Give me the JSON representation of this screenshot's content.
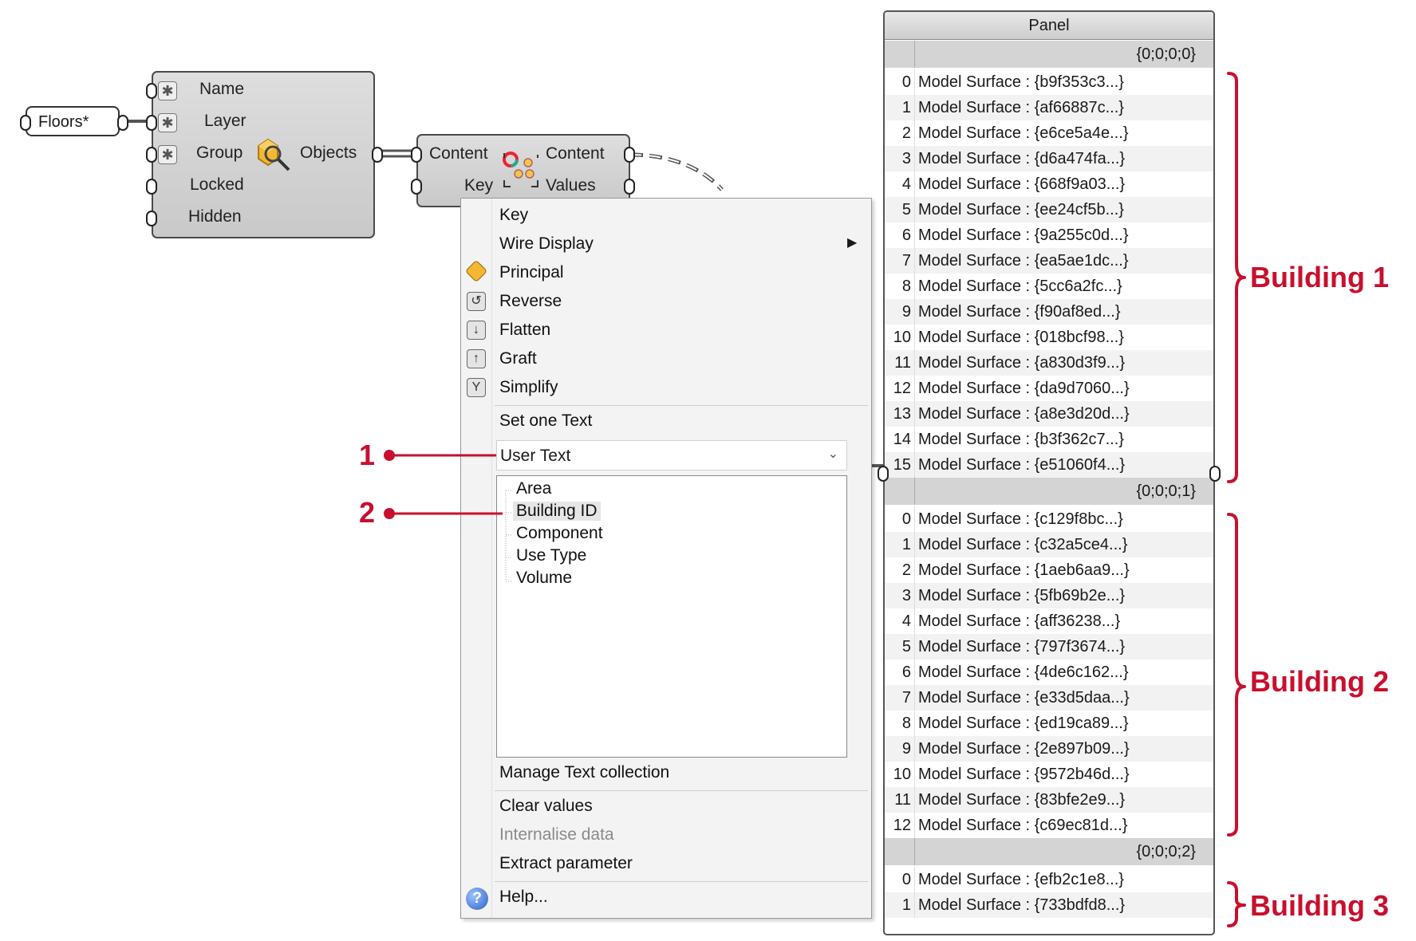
{
  "colors": {
    "annotation": "#c8102e",
    "panel_header": "#d4d4d4",
    "component": "#d2d2d2"
  },
  "floors": {
    "label": "Floors*"
  },
  "query": {
    "inputs": [
      "Name",
      "Layer",
      "Group",
      "Locked",
      "Hidden"
    ],
    "output": "Objects",
    "icon": "magnifier-query-icon"
  },
  "usertext": {
    "inputs": [
      "Content",
      "Key"
    ],
    "outputs": [
      "Content",
      "Values"
    ],
    "icon": "color-circles-icon"
  },
  "menu": {
    "items": [
      {
        "label": "Key",
        "icon": ""
      },
      {
        "label": "Wire Display",
        "icon": "",
        "submenu": true
      },
      {
        "label": "Principal",
        "icon": "principal-icon"
      },
      {
        "label": "Reverse",
        "icon": "reverse-icon"
      },
      {
        "label": "Flatten",
        "icon": "flatten-icon"
      },
      {
        "label": "Graft",
        "icon": "graft-icon"
      },
      {
        "label": "Simplify",
        "icon": "simplify-icon"
      }
    ],
    "set_one_text": "Set one Text",
    "combo_value": "User Text",
    "list_items": [
      "Area",
      "Building  ID",
      "Component",
      "Use  Type",
      "Volume"
    ],
    "selected_index": 1,
    "manage": "Manage Text collection",
    "clear": "Clear values",
    "internalise": "Internalise data",
    "extract": "Extract parameter",
    "help": "Help..."
  },
  "panel": {
    "title": "Panel",
    "branches": [
      {
        "path": "{0;0;0;0}",
        "items": [
          "{b9f353c3...}",
          "{af66887c...}",
          "{e6ce5a4e...}",
          "{d6a474fa...}",
          "{668f9a03...}",
          "{ee24cf5b...}",
          "{9a255c0d...}",
          "{ea5ae1dc...}",
          "{5cc6a2fc...}",
          "{f90af8ed...}",
          "{018bcf98...}",
          "{a830d3f9...}",
          "{da9d7060...}",
          "{a8e3d20d...}",
          "{b3f362c7...}",
          "{e51060f4...}"
        ]
      },
      {
        "path": "{0;0;0;1}",
        "items": [
          "{c129f8bc...}",
          "{c32a5ce4...}",
          "{1aeb6aa9...}",
          "{5fb69b2e...}",
          "{aff36238...}",
          "{797f3674...}",
          "{4de6c162...}",
          "{e33d5daa...}",
          "{ed19ca89...}",
          "{2e897b09...}",
          "{9572b46d...}",
          "{83bfe2e9...}",
          "{c69ec81d...}"
        ]
      },
      {
        "path": "{0;0;0;2}",
        "items": [
          "{efb2c1e8...}",
          "{733bdfd8...}"
        ]
      }
    ],
    "item_prefix": "Model Surface : "
  },
  "annotations": {
    "buildings": [
      "Building 1",
      "Building 2",
      "Building 3"
    ],
    "markers": [
      "1",
      "2"
    ]
  }
}
